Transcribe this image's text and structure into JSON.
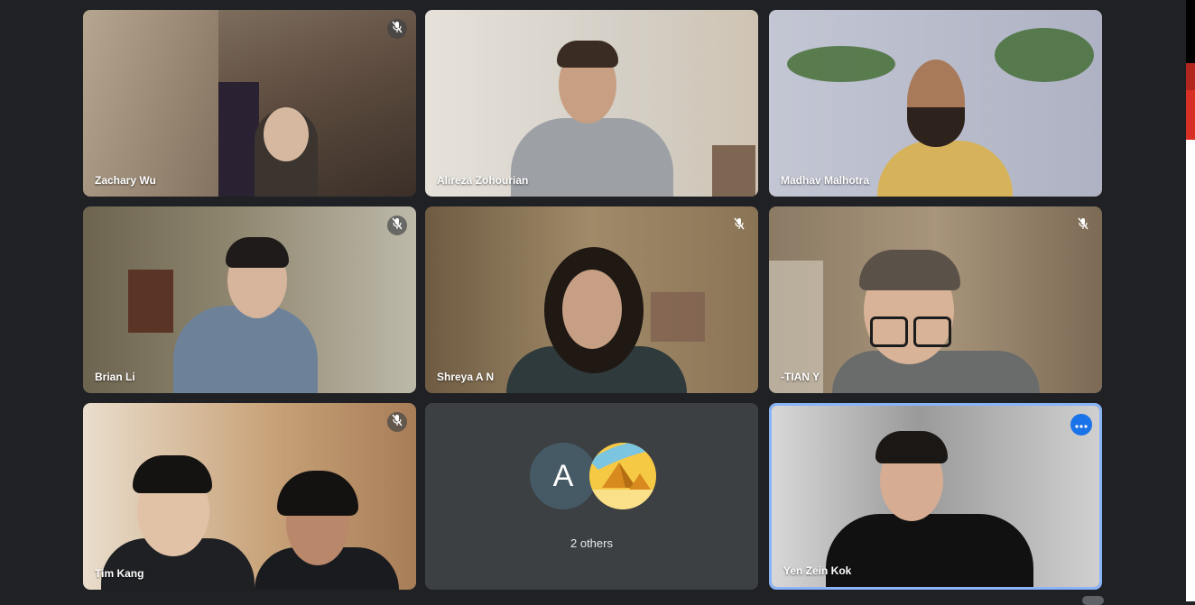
{
  "participants": [
    {
      "id": "zachary",
      "name": "Zachary Wu",
      "muted": true,
      "bg": "#6e5a4a"
    },
    {
      "id": "alireza",
      "name": "Alireza Zohourian",
      "muted": false,
      "bg": "#d9d4cb"
    },
    {
      "id": "madhav",
      "name": "Madhav Malhotra",
      "muted": false,
      "bg": "#b9bcc9"
    },
    {
      "id": "brian",
      "name": "Brian Li",
      "muted": true,
      "bg": "#7f7560"
    },
    {
      "id": "shreya",
      "name": "Shreya A N",
      "muted": true,
      "bg": "#8a7456"
    },
    {
      "id": "tian",
      "name": "-TIAN Y",
      "muted": true,
      "bg": "#8c7a63"
    },
    {
      "id": "tim",
      "name": "Tim Kang",
      "muted": true,
      "bg": "#b5906d"
    },
    {
      "id": "yen",
      "name": "Yen Zein Kok",
      "muted": false,
      "active": true,
      "bg": "#a9a9a9"
    }
  ],
  "others": {
    "avatar_letter": "A",
    "label": "2 others"
  },
  "colors": {
    "background": "#202124",
    "tile_empty": "#3c4043",
    "active_border": "#8ab4f8",
    "more_button": "#1a73e8",
    "avatar_a": "#455a64",
    "avatar_pyramid_bg": "#f6c945"
  },
  "icons": {
    "mute": "mic-off-icon",
    "more": "more-horizontal-icon",
    "pyramid": "pyramid-avatar-icon"
  }
}
